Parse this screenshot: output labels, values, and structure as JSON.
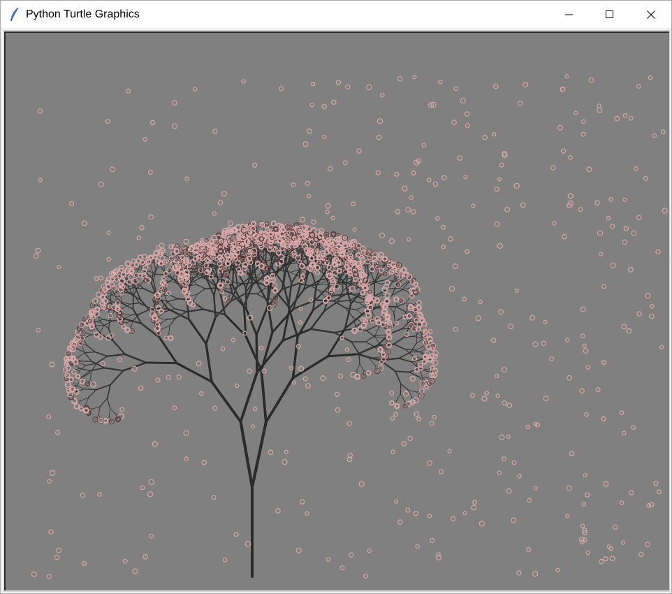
{
  "window": {
    "title": "Python Turtle Graphics",
    "app_icon": "feather-icon",
    "controls": {
      "minimize": "minimize-icon",
      "maximize": "maximize-icon",
      "close": "close-icon"
    }
  },
  "canvas": {
    "background": "#808080",
    "trunk_color": "#2b2b2b",
    "branch_color": "#333333",
    "petal_color": "#d8a8a8",
    "petal_dark_color": "#5a4040"
  }
}
